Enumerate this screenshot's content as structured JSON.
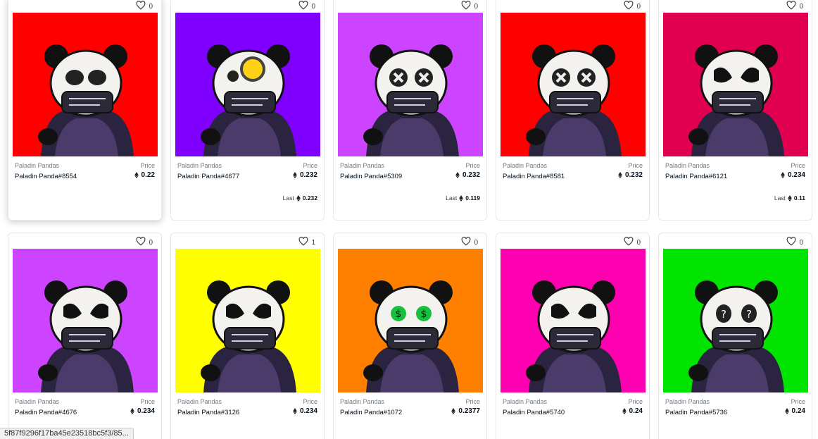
{
  "cards": [
    {
      "likes": "0",
      "collection": "Paladin Pandas",
      "price_label": "Price",
      "name": "Paladin Panda#8554",
      "price": "0.22",
      "last_label": "",
      "last_price": "",
      "bg": "#ff0000",
      "eyes": "skull"
    },
    {
      "likes": "0",
      "collection": "Paladin Pandas",
      "price_label": "Price",
      "name": "Paladin Panda#4677",
      "price": "0.232",
      "last_label": "Last",
      "last_price": "0.232",
      "bg": "#8000ff",
      "eyes": "visor"
    },
    {
      "likes": "0",
      "collection": "Paladin Pandas",
      "price_label": "Price",
      "name": "Paladin Panda#5309",
      "price": "0.232",
      "last_label": "Last",
      "last_price": "0.119",
      "bg": "#cc44ff",
      "eyes": "x"
    },
    {
      "likes": "0",
      "collection": "Paladin Pandas",
      "price_label": "Price",
      "name": "Paladin Panda#8581",
      "price": "0.232",
      "last_label": "",
      "last_price": "",
      "bg": "#ff0000",
      "eyes": "x"
    },
    {
      "likes": "0",
      "collection": "Paladin Pandas",
      "price_label": "Price",
      "name": "Paladin Panda#6121",
      "price": "0.234",
      "last_label": "Last",
      "last_price": "0.11",
      "bg": "#e0004f",
      "eyes": "paint"
    },
    {
      "likes": "0",
      "collection": "Paladin Pandas",
      "price_label": "Price",
      "name": "Paladin Panda#4676",
      "price": "0.234",
      "last_label": "",
      "last_price": "",
      "bg": "#cc44ff",
      "eyes": "paint"
    },
    {
      "likes": "1",
      "collection": "Paladin Pandas",
      "price_label": "Price",
      "name": "Paladin Panda#3126",
      "price": "0.234",
      "last_label": "",
      "last_price": "",
      "bg": "#ffff00",
      "eyes": "paint"
    },
    {
      "likes": "0",
      "collection": "Paladin Pandas",
      "price_label": "Price",
      "name": "Paladin Panda#1072",
      "price": "0.2377",
      "last_label": "",
      "last_price": "",
      "bg": "#ff8000",
      "eyes": "dollar"
    },
    {
      "likes": "0",
      "collection": "Paladin Pandas",
      "price_label": "Price",
      "name": "Paladin Panda#5740",
      "price": "0.24",
      "last_label": "",
      "last_price": "",
      "bg": "#ff00b0",
      "eyes": "paint"
    },
    {
      "likes": "0",
      "collection": "Paladin Pandas",
      "price_label": "Price",
      "name": "Paladin Panda#5736",
      "price": "0.24",
      "last_label": "",
      "last_price": "",
      "bg": "#00e400",
      "eyes": "question"
    }
  ],
  "status_url": "5f87f9296f17ba45e23518bc5f3/85..."
}
